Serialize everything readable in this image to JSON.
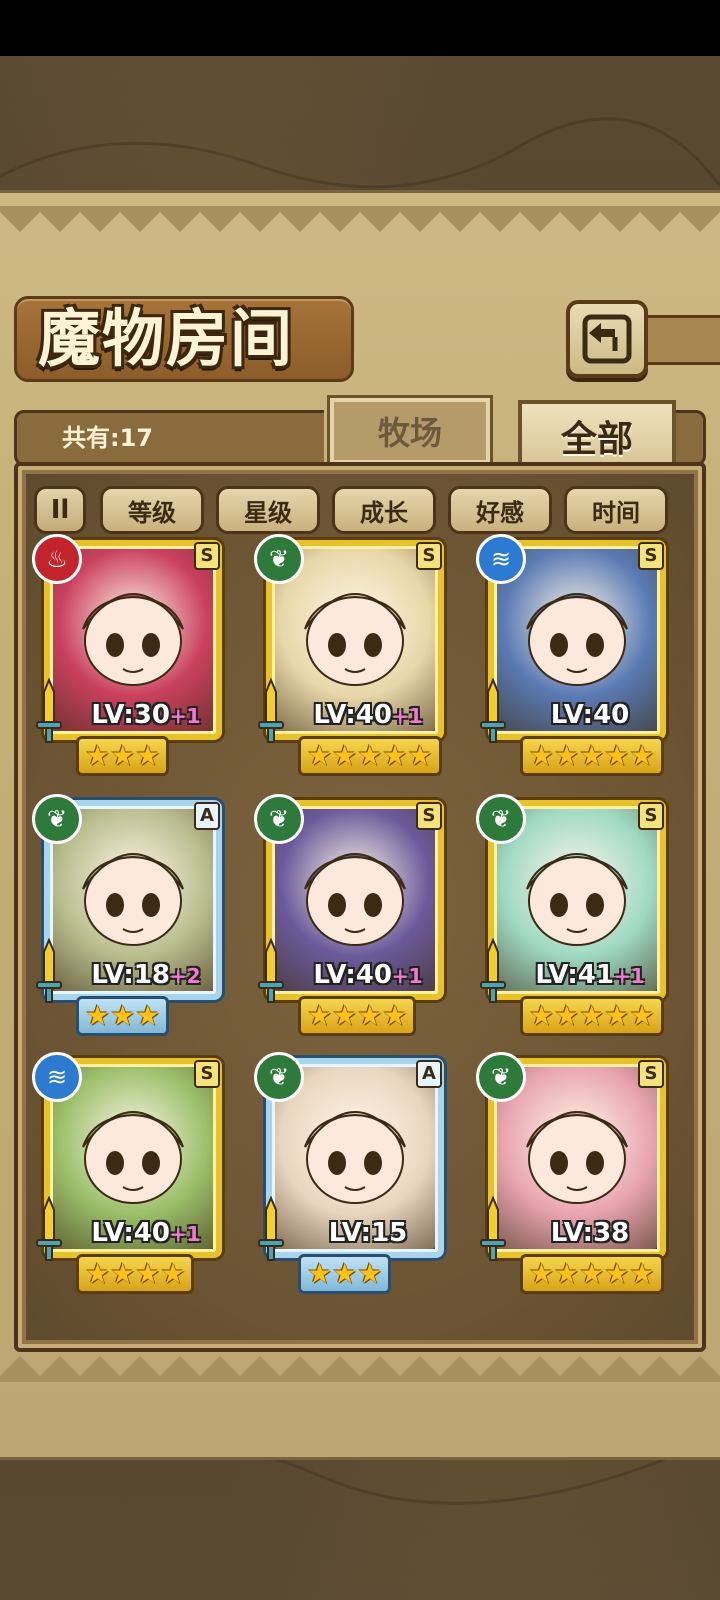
{
  "title": "魔物房间",
  "count_label": "共有:17",
  "tabs": {
    "farm": "牧场",
    "all": "全部"
  },
  "sort": {
    "toggle_label": "Il",
    "buttons": [
      "等级",
      "星级",
      "成长",
      "好感",
      "时间"
    ]
  },
  "colors": {
    "fire": "#c3232a",
    "wood": "#2e7a3a",
    "water": "#2c7bd1",
    "gold_frame": "#e8c22a",
    "blue_frame": "#a8d4ee"
  },
  "cards": [
    {
      "element": "fire-icon",
      "rank": "S",
      "lv": "LV:30",
      "plus": "+1",
      "stars": 3,
      "portrait": "#c9405e"
    },
    {
      "element": "leaf-icon",
      "rank": "S",
      "lv": "LV:40",
      "plus": "+1",
      "stars": 5,
      "portrait": "#e8d7a8"
    },
    {
      "element": "water-icon",
      "rank": "S",
      "lv": "LV:40",
      "plus": "",
      "stars": 5,
      "portrait": "#5a7ab3"
    },
    {
      "element": "leaf-icon",
      "rank": "A",
      "lv": "LV:18",
      "plus": "+2",
      "stars": 3,
      "portrait": "#b9bd8e"
    },
    {
      "element": "leaf-icon",
      "rank": "S",
      "lv": "LV:40",
      "plus": "+1",
      "stars": 4,
      "portrait": "#6b5a9a"
    },
    {
      "element": "leaf-icon",
      "rank": "S",
      "lv": "LV:41",
      "plus": "+1",
      "stars": 5,
      "portrait": "#9fd9c2"
    },
    {
      "element": "water-icon",
      "rank": "S",
      "lv": "LV:40",
      "plus": "+1",
      "stars": 4,
      "portrait": "#9bbf6a"
    },
    {
      "element": "leaf-icon",
      "rank": "A",
      "lv": "LV:15",
      "plus": "",
      "stars": 3,
      "portrait": "#e9d6bf"
    },
    {
      "element": "leaf-icon",
      "rank": "S",
      "lv": "LV:38",
      "plus": "",
      "stars": 5,
      "portrait": "#e8a5b0"
    }
  ]
}
